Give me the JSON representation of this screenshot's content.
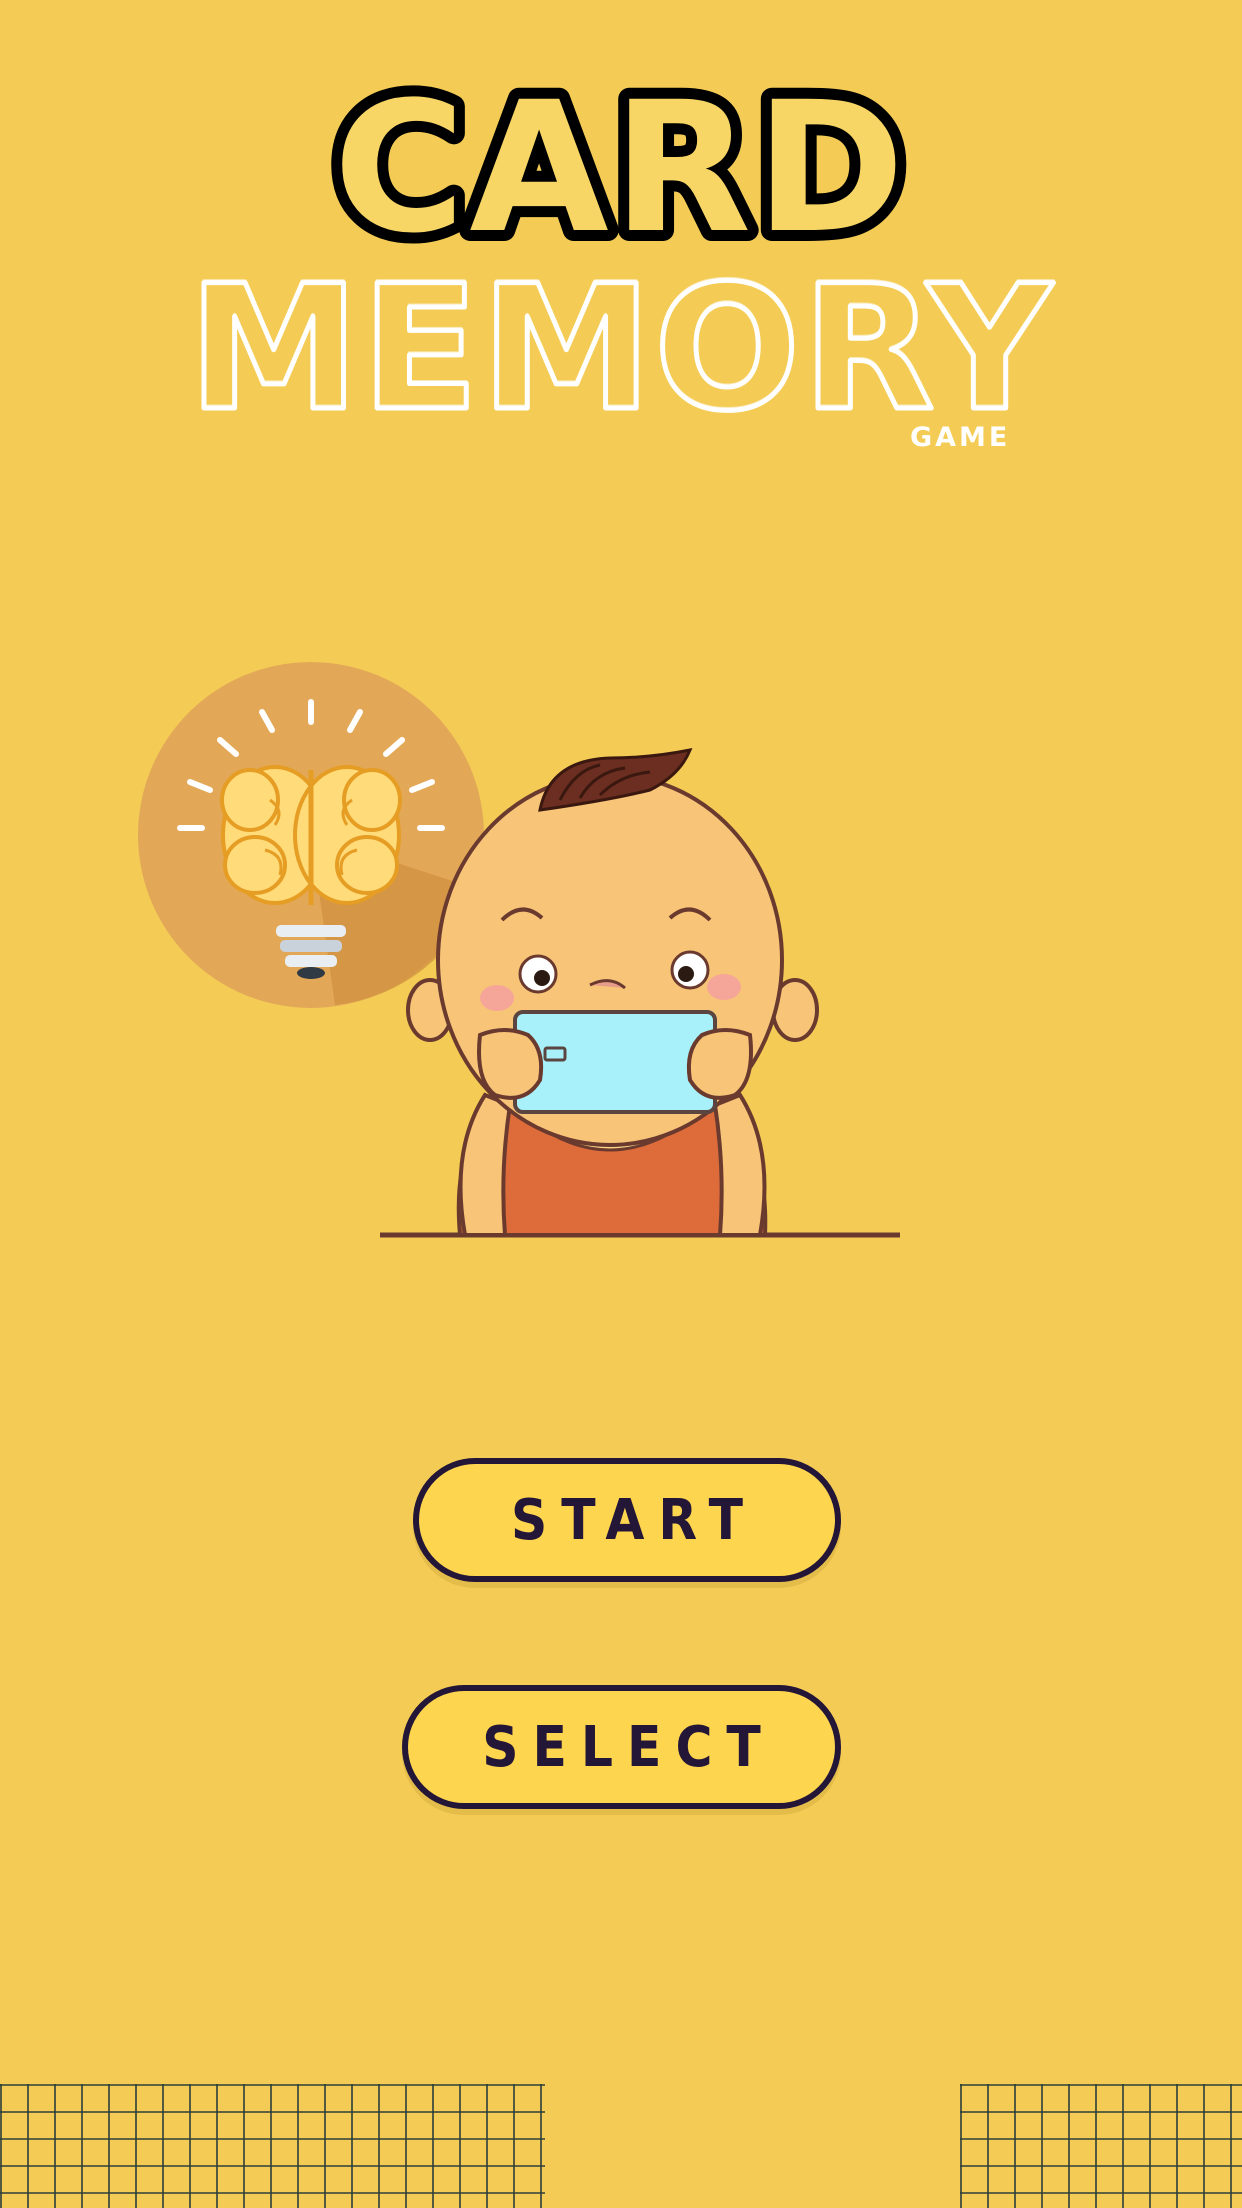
{
  "title": {
    "line1": "CARD",
    "line2": "MEMORY",
    "line3": "GAME"
  },
  "illustration": {
    "icons": [
      "brain-lightbulb-icon",
      "child-with-phone-illustration"
    ]
  },
  "buttons": {
    "start_label": "START",
    "select_label": "SELECT"
  },
  "colors": {
    "background": "#F4CC55",
    "button_fill": "#FDD54E",
    "button_outline": "#231636",
    "brain_circle": "#E3A857",
    "grid_lines": "#2C3E3A"
  }
}
